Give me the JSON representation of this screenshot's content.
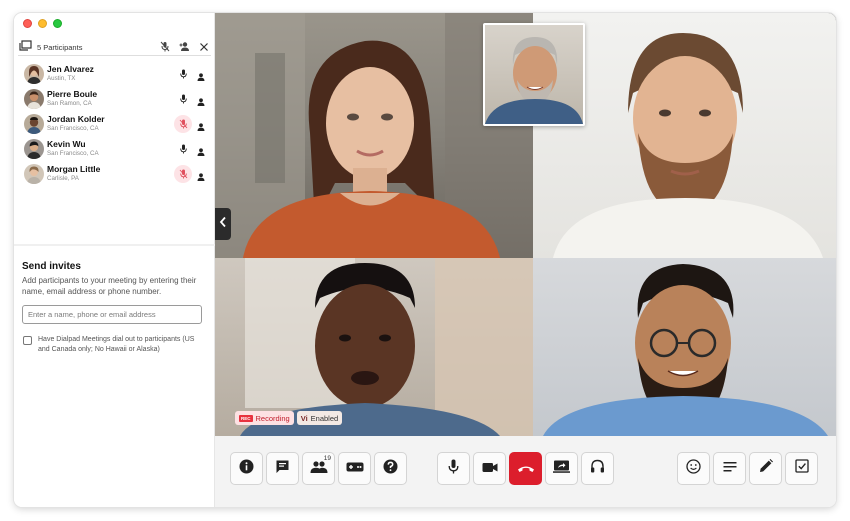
{
  "sidebar": {
    "participant_count": "5 Participants",
    "participants": [
      {
        "name": "Jen Alvarez",
        "location": "Austin, TX",
        "mic": "on"
      },
      {
        "name": "Pierre Boule",
        "location": "San Ramon, CA",
        "mic": "on"
      },
      {
        "name": "Jordan Kolder",
        "location": "San Francisco, CA",
        "mic": "muted"
      },
      {
        "name": "Kevin Wu",
        "location": "San Francisco, CA",
        "mic": "on"
      },
      {
        "name": "Morgan Little",
        "location": "Carlisle, PA",
        "mic": "muted"
      }
    ],
    "invite": {
      "title": "Send invites",
      "description": "Add participants to your meeting by entering their name, email address or phone number.",
      "placeholder": "Enter a name, phone or email address",
      "dialout_label": "Have Dialpad Meetings dial out to participants (US and Canada only; No Hawaii or Alaska)"
    }
  },
  "badges": {
    "recording_icon": "REC",
    "recording_label": "Recording",
    "vi_icon": "Vi",
    "vi_label": "Enabled"
  },
  "toolbar": {
    "left": [
      "info-icon",
      "chat-icon",
      "participants-icon",
      "apps-icon",
      "help-icon"
    ],
    "participants_count": "19",
    "center": [
      "microphone-icon",
      "camera-icon",
      "end-call-icon",
      "screen-share-icon",
      "headset-icon"
    ],
    "right": [
      "emoji-icon",
      "notes-icon",
      "pencil-icon",
      "checklist-icon"
    ]
  },
  "colors": {
    "end_call": "#dc1e2c",
    "muted_mic_bg": "#fde3e6",
    "recording": "#e8323f"
  }
}
